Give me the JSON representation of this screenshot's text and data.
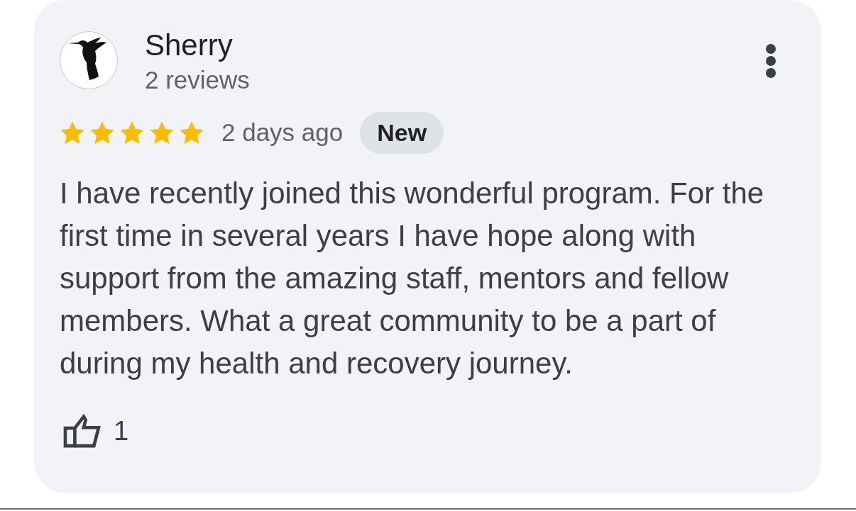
{
  "review": {
    "author": {
      "name": "Sherry",
      "review_count": "2 reviews"
    },
    "stars": 5,
    "time": "2 days ago",
    "badge": "New",
    "text": "I have recently joined this wonderful program. For the first time in several years I have hope along with support from the amazing staff, mentors and fellow members. What a great community to be a part of during my health and recovery journey.",
    "likes": "1"
  }
}
